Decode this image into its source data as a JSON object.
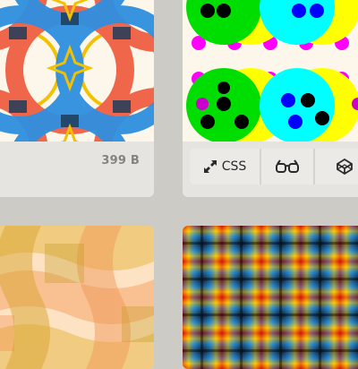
{
  "cards": [
    {
      "id": "tl",
      "pattern": "rings-and-stars",
      "size_label": "399 B"
    },
    {
      "id": "tr",
      "pattern": "polka-circles",
      "buttons": {
        "css_label": "CSS",
        "css_icon": "expand-arrows-icon",
        "view_icon": "glasses-icon",
        "pen_icon": "codepen-cube-icon"
      }
    },
    {
      "id": "bl",
      "pattern": "warm-waves"
    },
    {
      "id": "br",
      "pattern": "rainbow-plaid"
    }
  ],
  "colors": {
    "page_bg": "#cdcbc6",
    "card_bg": "#e5e4e1",
    "ring_blue": "#2f8fe0",
    "ring_red": "#f0664a",
    "ring_yellow": "#f2c200",
    "dot_magenta": "#ff00ff",
    "dot_green": "#00dd00",
    "dot_cyan": "#00ffff",
    "dot_yellow": "#ffff00"
  }
}
